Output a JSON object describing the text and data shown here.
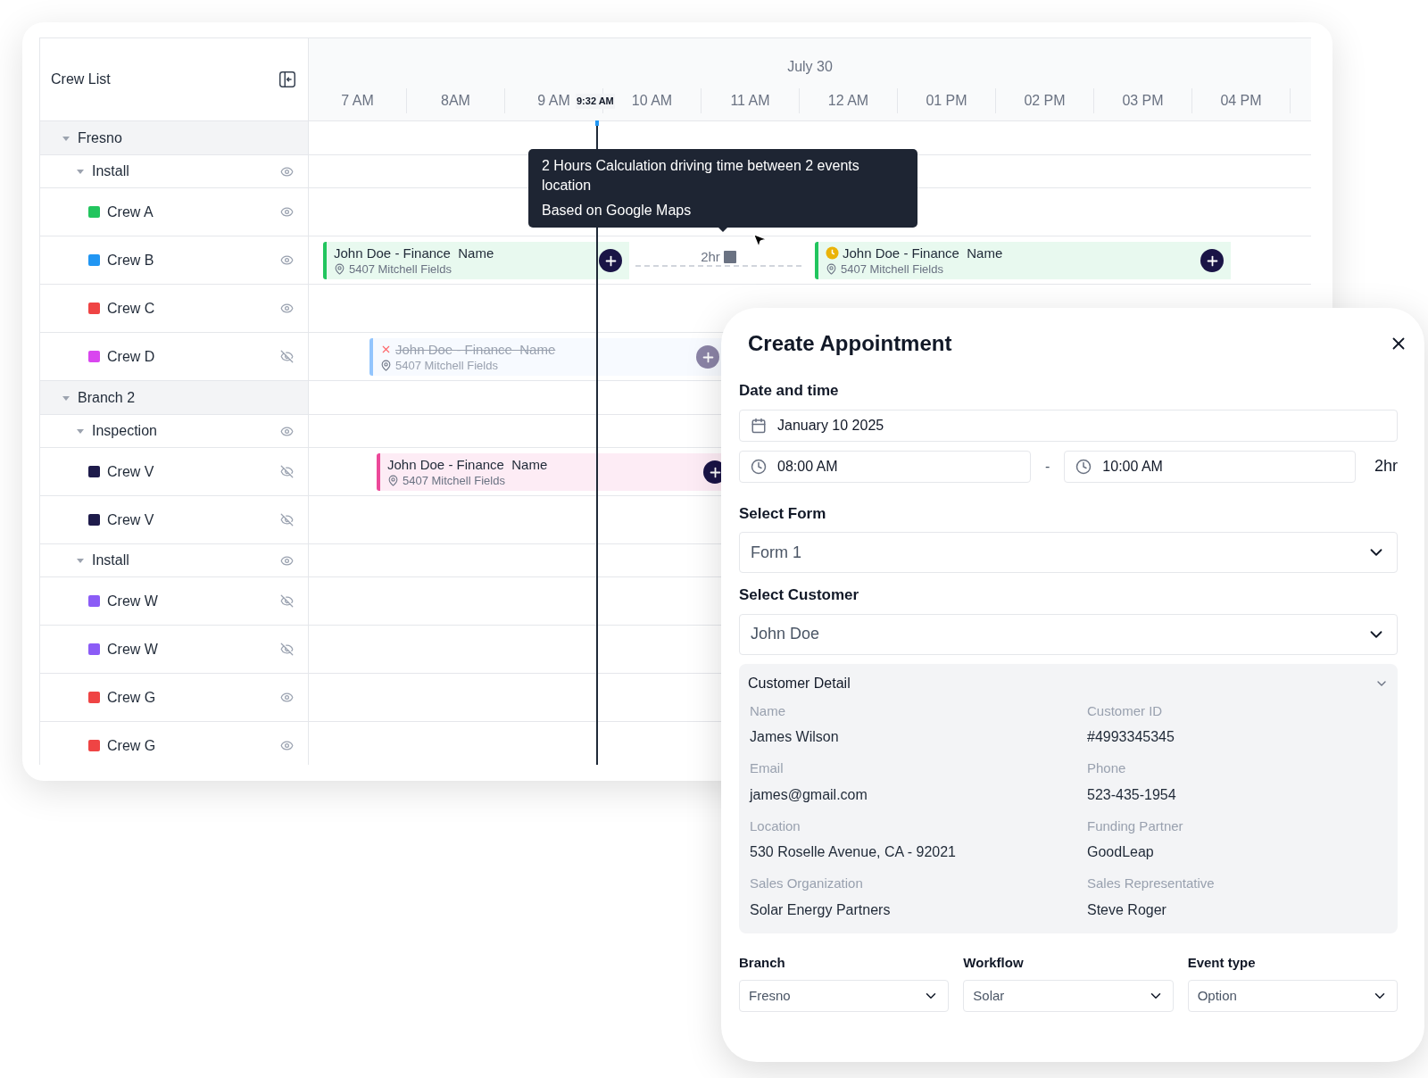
{
  "crew_list": {
    "title": "Crew List"
  },
  "timeline": {
    "date": "July 30",
    "hours": [
      "7 AM",
      "8AM",
      "9 AM",
      "10 AM",
      "11 AM",
      "12 AM",
      "01 PM",
      "02 PM",
      "03 PM",
      "04 PM"
    ],
    "now_label": "9:32 AM"
  },
  "groups": [
    {
      "name": "Fresno",
      "expanded": true,
      "children": [
        {
          "name": "Install",
          "expanded": true,
          "visible": true,
          "children": [
            {
              "name": "Crew A",
              "color": "#22c55e",
              "visible": true
            },
            {
              "name": "Crew B",
              "color": "#2196f3",
              "visible": true,
              "travel": {
                "label": "2hr"
              },
              "events": [
                {
                  "title": "John Doe - Finance  Name",
                  "address": "5407 Mitchell Fields",
                  "color": "#22c55e",
                  "kind": "scheduled"
                },
                {
                  "title": "John Doe - Finance  Name",
                  "address": "5407 Mitchell Fields",
                  "color": "#22c55e",
                  "kind": "pending"
                }
              ]
            },
            {
              "name": "Crew C",
              "color": "#ef4444",
              "visible": true
            },
            {
              "name": "Crew D",
              "color": "#d946ef",
              "visible": false,
              "events": [
                {
                  "title": "John Doe - Finance  Name",
                  "address": "5407 Mitchell Fields",
                  "color": "#93c5fd",
                  "kind": "cancelled"
                }
              ]
            }
          ]
        }
      ]
    },
    {
      "name": "Branch 2",
      "expanded": true,
      "children": [
        {
          "name": "Inspection",
          "expanded": true,
          "visible": true,
          "children": [
            {
              "name": "Crew V",
              "color": "#1e1b4b",
              "visible": false,
              "events": [
                {
                  "title": "John Doe - Finance  Name",
                  "address": "5407 Mitchell Fields",
                  "color": "#ec4899",
                  "kind": "scheduled"
                }
              ]
            },
            {
              "name": "Crew V",
              "color": "#1e1b4b",
              "visible": false
            }
          ]
        },
        {
          "name": "Install",
          "expanded": true,
          "visible": true,
          "children": [
            {
              "name": "Crew W",
              "color": "#8b5cf6",
              "visible": false
            },
            {
              "name": "Crew W",
              "color": "#8b5cf6",
              "visible": false
            },
            {
              "name": "Crew G",
              "color": "#ef4444",
              "visible": true
            },
            {
              "name": "Crew G",
              "color": "#ef4444",
              "visible": true
            }
          ]
        }
      ]
    }
  ],
  "tooltip": {
    "lines": [
      "2 Hours Calculation driving time between 2 events location",
      "Based on Google Maps"
    ]
  },
  "appointment": {
    "title": "Create Appointment",
    "date_time": {
      "label": "Date and time",
      "date": "January 10 2025",
      "start": "08:00 AM",
      "separator": "-",
      "end": "10:00 AM",
      "duration": "2hr"
    },
    "form": {
      "label": "Select Form",
      "value": "Form 1"
    },
    "customer": {
      "label": "Select Customer",
      "value": "John Doe"
    },
    "detail": {
      "title": "Customer Detail",
      "expanded": true,
      "fields": [
        {
          "label": "Name",
          "value": "James Wilson"
        },
        {
          "label": "Customer ID",
          "value": "#4993345345"
        },
        {
          "label": "Email",
          "value": "james@gmail.com"
        },
        {
          "label": "Phone",
          "value": "523-435-1954"
        },
        {
          "label": "Location",
          "value": "530 Roselle Avenue, CA - 92021"
        },
        {
          "label": "Funding Partner",
          "value": "GoodLeap"
        },
        {
          "label": "Sales Organization",
          "value": "Solar Energy Partners"
        },
        {
          "label": "Sales Representative",
          "value": "Steve Roger"
        }
      ]
    },
    "selects": [
      {
        "label": "Branch",
        "value": "Fresno"
      },
      {
        "label": "Workflow",
        "value": "Solar"
      },
      {
        "label": "Event type",
        "value": "Option"
      }
    ]
  }
}
